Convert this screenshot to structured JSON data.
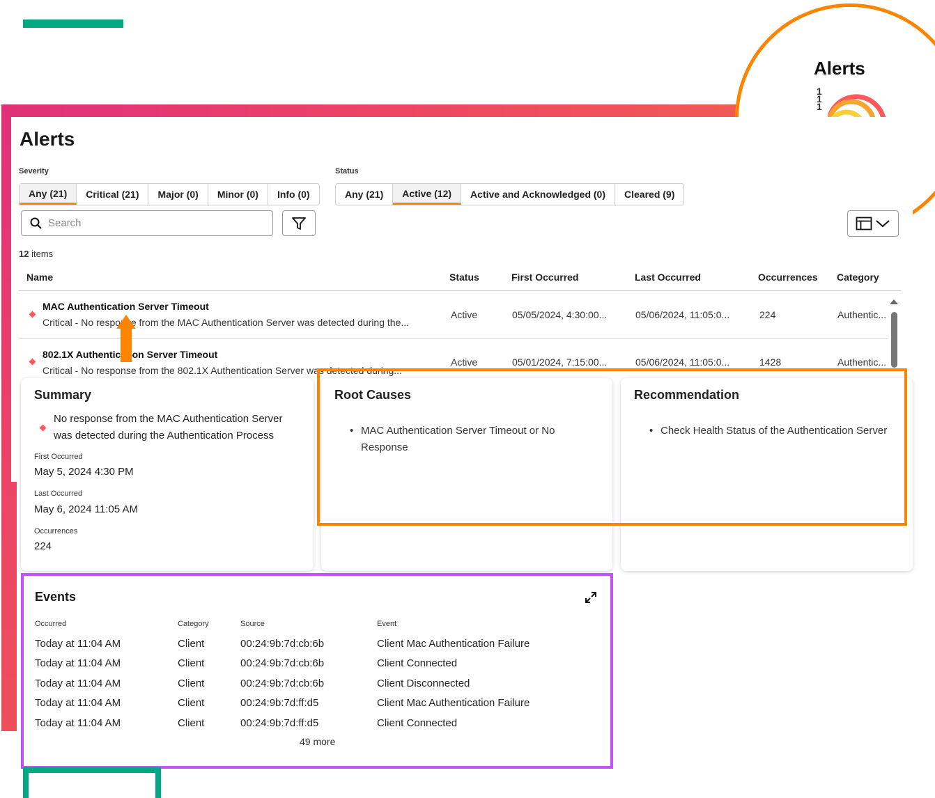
{
  "zoom": {
    "title": "Alerts",
    "indicator_nums": [
      "1",
      "1",
      "1"
    ]
  },
  "page": {
    "title": "Alerts"
  },
  "filters": {
    "severity_label": "Severity",
    "severity": [
      "Any (21)",
      "Critical (21)",
      "Major (0)",
      "Minor (0)",
      "Info (0)"
    ],
    "status_label": "Status",
    "status": [
      "Any (21)",
      "Active (12)",
      "Active and Acknowledged (0)",
      "Cleared (9)"
    ]
  },
  "search": {
    "placeholder": "Search"
  },
  "items_count": {
    "number": "12",
    "suffix": "items"
  },
  "table": {
    "columns": [
      "Name",
      "Status",
      "First Occurred",
      "Last Occurred",
      "Occurrences",
      "Category"
    ],
    "rows": [
      {
        "name": "MAC Authentication Server Timeout",
        "description": "Critical - No response from the MAC Authentication Server was detected during the...",
        "status": "Active",
        "first": "05/05/2024, 4:30:00...",
        "last": "05/06/2024, 11:05:0...",
        "occurrences": "224",
        "category": "Authentic..."
      },
      {
        "name": "802.1X Authentication Server Timeout",
        "description": "Critical - No response from the 802.1X Authentication Server was detected during...",
        "status": "Active",
        "first": "05/01/2024, 7:15:00...",
        "last": "05/06/2024, 11:05:0...",
        "occurrences": "1428",
        "category": "Authentic..."
      }
    ]
  },
  "summary": {
    "title": "Summary",
    "message_line1": "No response from the MAC Authentication Server",
    "message_line2": "was detected during the Authentication Process",
    "first_label": "First Occurred",
    "first_value": "May 5, 2024 4:30 PM",
    "last_label": "Last Occurred",
    "last_value": "May 6, 2024 11:05 AM",
    "occ_label": "Occurrences",
    "occ_value": "224"
  },
  "root_causes": {
    "title": "Root Causes",
    "items": [
      "MAC Authentication Server Timeout or No Response"
    ]
  },
  "recommendation": {
    "title": "Recommendation",
    "items": [
      "Check Health Status of the Authentication Server"
    ]
  },
  "events": {
    "title": "Events",
    "columns": [
      "Occurred",
      "Category",
      "Source",
      "Event"
    ],
    "rows": [
      [
        "Today at 11:04 AM",
        "Client",
        "00:24:9b:7d:cb:6b",
        "Client Mac Authentication Failure"
      ],
      [
        "Today at 11:04 AM",
        "Client",
        "00:24:9b:7d:cb:6b",
        "Client Connected"
      ],
      [
        "Today at 11:04 AM",
        "Client",
        "00:24:9b:7d:cb:6b",
        "Client Disconnected"
      ],
      [
        "Today at 11:04 AM",
        "Client",
        "00:24:9b:7d:ff:d5",
        "Client Mac Authentication Failure"
      ],
      [
        "Today at 11:04 AM",
        "Client",
        "00:24:9b:7d:ff:d5",
        "Client Connected"
      ]
    ],
    "more": "49 more"
  },
  "colors": {
    "accent_orange": "#fb8500",
    "brand_green": "#01a982",
    "critical": "#fc5a5a",
    "highlight_purple": "#c054f5"
  }
}
